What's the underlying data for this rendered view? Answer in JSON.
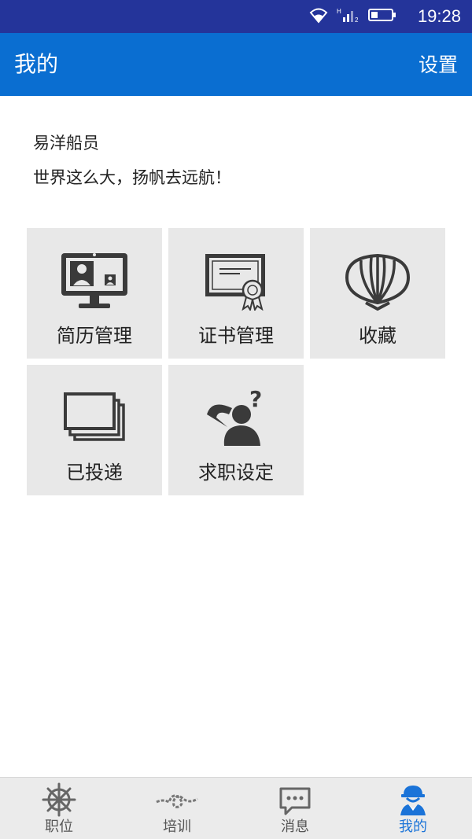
{
  "status_bar": {
    "time": "19:28",
    "icons": [
      "wifi-icon",
      "signal-icon",
      "battery-icon"
    ]
  },
  "app_bar": {
    "title": "我的",
    "settings_label": "设置"
  },
  "profile": {
    "name": "易洋船员",
    "motto": "世界这么大，扬帆去远航！"
  },
  "tiles": [
    {
      "label": "简历管理",
      "icon": "resume-monitor-icon"
    },
    {
      "label": "证书管理",
      "icon": "certificate-icon"
    },
    {
      "label": "收藏",
      "icon": "shell-icon"
    },
    {
      "label": "已投递",
      "icon": "stacked-cards-icon"
    },
    {
      "label": "求职设定",
      "icon": "thinking-person-icon"
    }
  ],
  "bottom_nav": {
    "items": [
      {
        "label": "职位",
        "icon": "ship-wheel-icon"
      },
      {
        "label": "培训",
        "icon": "rope-knot-icon"
      },
      {
        "label": "消息",
        "icon": "chat-bubble-icon"
      },
      {
        "label": "我的",
        "icon": "sailor-helmet-icon"
      }
    ],
    "active_index": 3
  },
  "colors": {
    "status_bar": "#24349a",
    "app_bar": "#0a6ed1",
    "tile_bg": "#e8e8e8",
    "icon_dark": "#3a3a3a",
    "nav_active": "#1a73d8"
  }
}
